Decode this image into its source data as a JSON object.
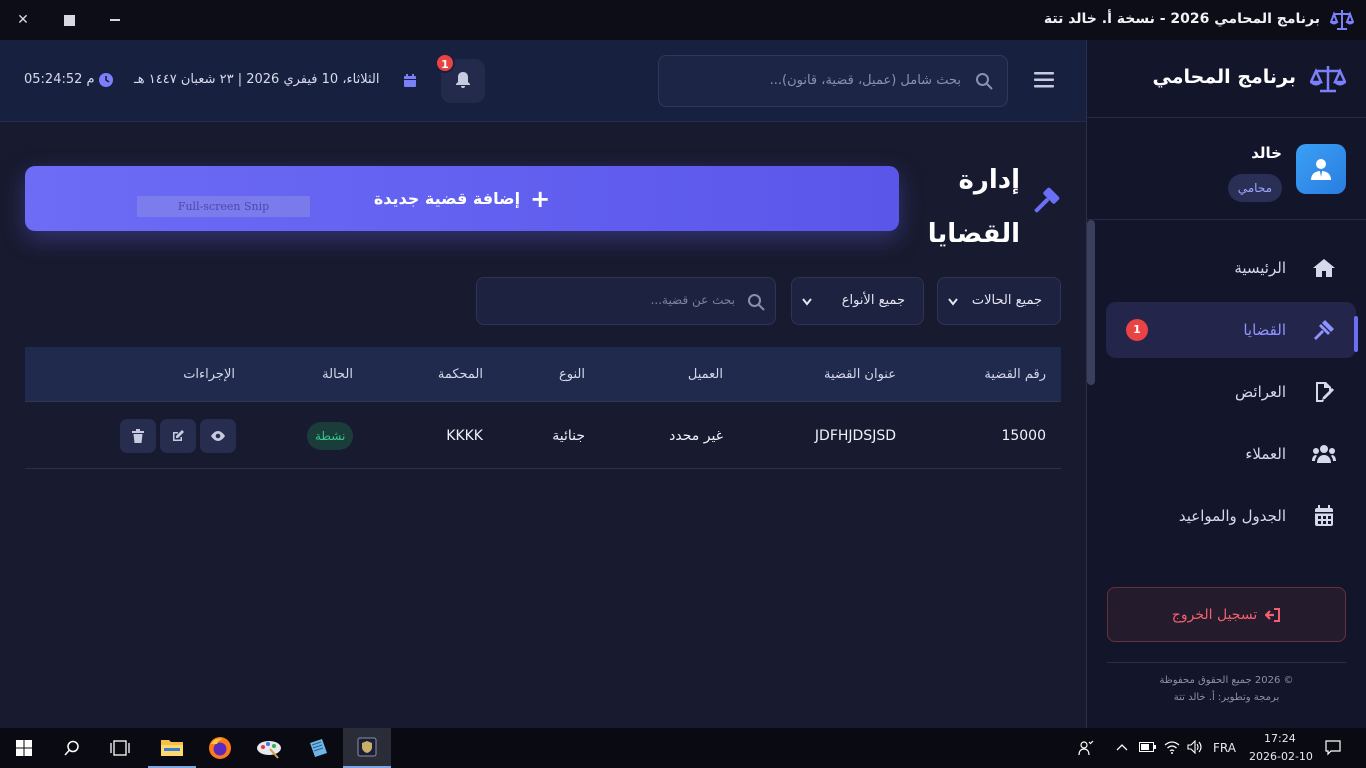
{
  "window": {
    "title": "برنامج المحامي 2026 - نسخة أ. خالد تتة",
    "close_glyph": "✕"
  },
  "sidebar": {
    "brand": "برنامج المحامي",
    "user": {
      "name": "خالد",
      "role": "محامي"
    },
    "items": [
      {
        "label": "الرئيسية",
        "icon": "home-icon"
      },
      {
        "label": "القضايا",
        "icon": "gavel-icon",
        "badge": "1",
        "active": true
      },
      {
        "label": "العرائض",
        "icon": "file-signature-icon"
      },
      {
        "label": "العملاء",
        "icon": "users-icon"
      },
      {
        "label": "الجدول والمواعيد",
        "icon": "calendar-icon"
      }
    ],
    "logout": "تسجيل الخروج",
    "copyright_line1": "© 2026 جميع الحقوق محفوظة",
    "copyright_line2": "برمجة وتطوير: أ. خالد تتة"
  },
  "header": {
    "search_placeholder": "بحث شامل (عميل، قضية، قانون)...",
    "notifications_count": "1",
    "date": "الثلاثاء، 10 فيفري 2026 | ٢٣ شعبان ١٤٤٧ هـ",
    "time": "05:24:52 م"
  },
  "main": {
    "title": "إدارة القضايا",
    "add_button": "إضافة قضية جديدة",
    "snip_overlay": "Full-screen Snip",
    "filters": {
      "status": "جميع الحالات",
      "type": "جميع الأنواع",
      "search_placeholder": "بحث عن قضية..."
    },
    "table": {
      "headers": [
        "رقم القضية",
        "عنوان القضية",
        "العميل",
        "النوع",
        "المحكمة",
        "الحالة",
        "الإجراءات"
      ],
      "rows": [
        {
          "number": "15000",
          "title": "JDFHJDSJSD",
          "client": "غير محدد",
          "type": "جنائية",
          "court": "KKKK",
          "status": "نشطة"
        }
      ]
    }
  },
  "taskbar": {
    "language": "FRA",
    "time": "17:24",
    "date": "2026-02-10"
  },
  "colors": {
    "accent": "#6c6cf6",
    "danger": "#e94343",
    "success": "#36c58a",
    "background": "#181a2f"
  }
}
